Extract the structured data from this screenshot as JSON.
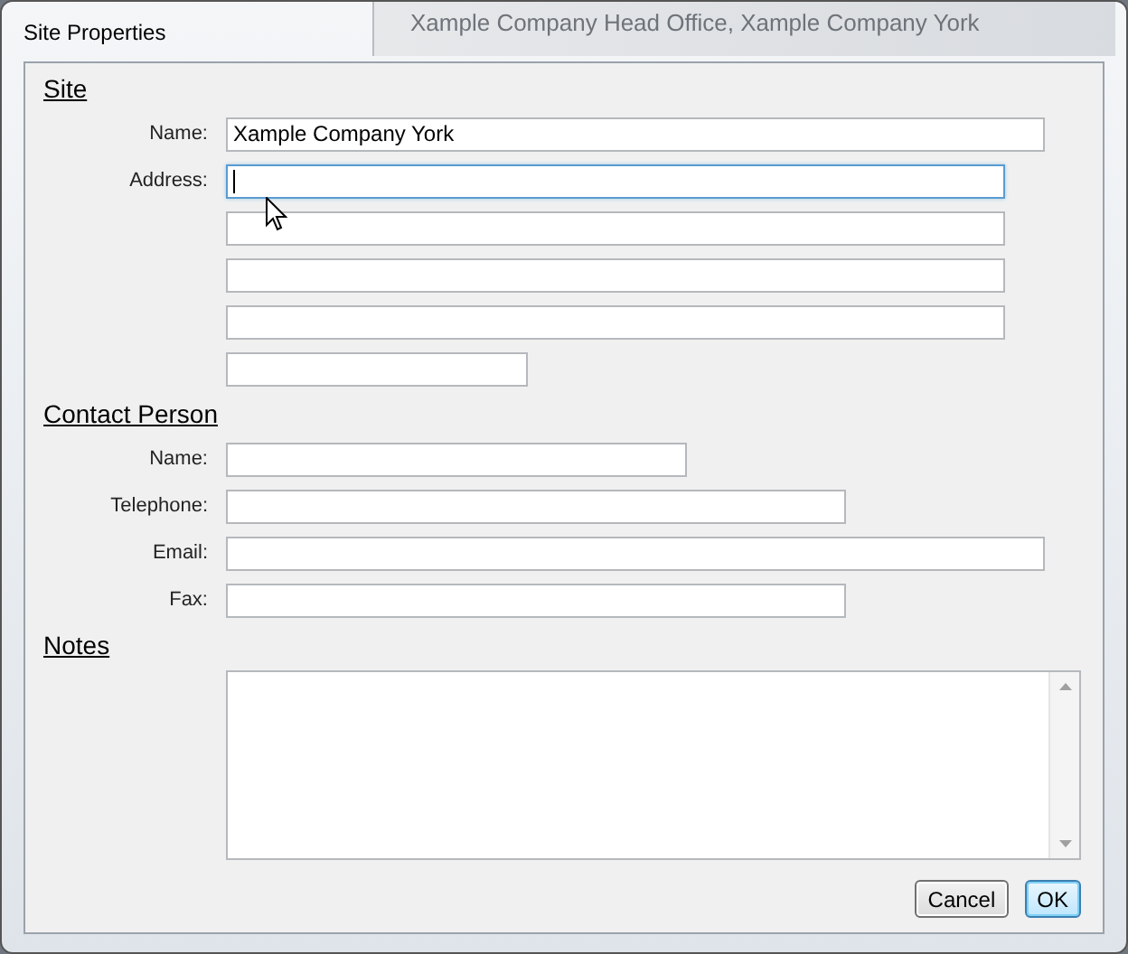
{
  "window": {
    "title": "Site Properties",
    "background_text": "Xample Company Head Office, Xample Company York"
  },
  "sections": [
    {
      "heading": "Site",
      "kind": "fields",
      "fields": [
        {
          "label": "Name:",
          "kind": "wide",
          "value": "Xample Company York",
          "focused": false
        },
        {
          "label": "Address:",
          "kind": "address",
          "focused": true
        },
        {
          "kind": "address",
          "focused": false
        },
        {
          "kind": "address",
          "focused": false
        },
        {
          "kind": "address",
          "focused": false
        },
        {
          "kind": "short",
          "focused": false
        }
      ]
    },
    {
      "heading": "Contact Person",
      "kind": "fields",
      "fields": [
        {
          "label": "Name:",
          "kind": "medium",
          "focused": false
        },
        {
          "label": "Telephone:",
          "kind": "long",
          "focused": false
        },
        {
          "label": "Email:",
          "kind": "wide",
          "focused": false
        },
        {
          "label": "Fax:",
          "kind": "long",
          "focused": false
        }
      ]
    },
    {
      "heading": "Notes",
      "kind": "notes"
    }
  ],
  "buttons": [
    {
      "label": "Cancel",
      "default": false
    },
    {
      "label": "OK",
      "default": true
    }
  ]
}
